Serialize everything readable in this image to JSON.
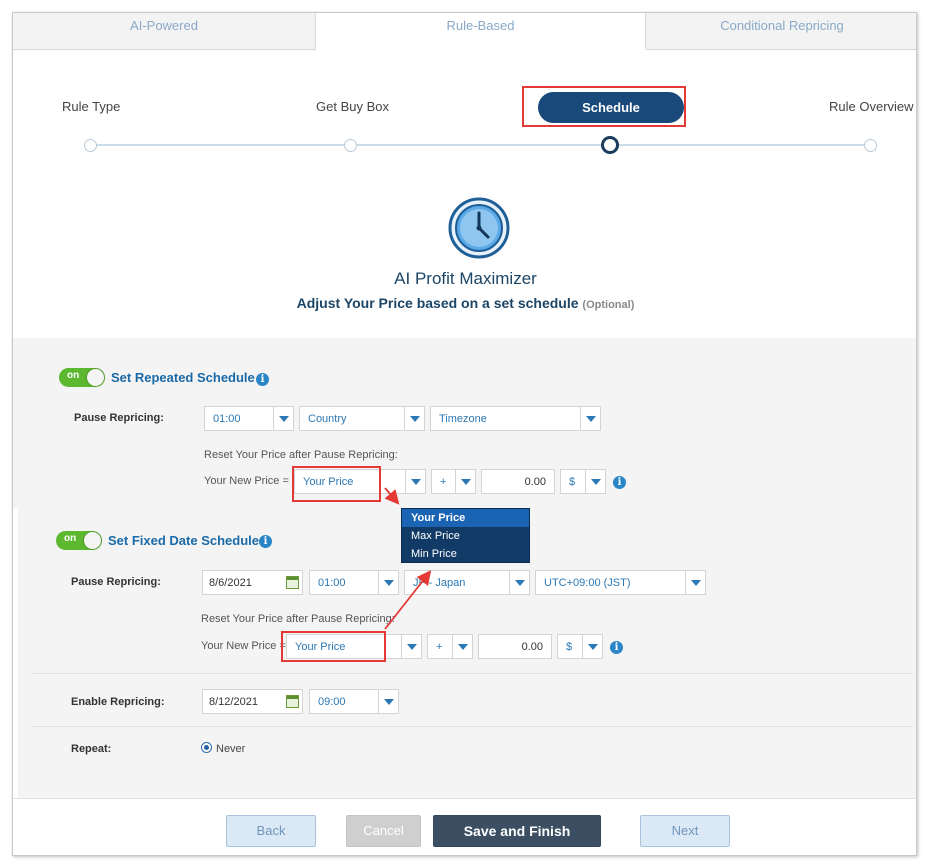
{
  "tabs": [
    {
      "label": "AI-Powered"
    },
    {
      "label": "Rule-Based"
    },
    {
      "label": "Conditional Repricing"
    }
  ],
  "steps": [
    {
      "label": "Rule Type"
    },
    {
      "label": "Get Buy Box"
    },
    {
      "label": "Schedule"
    },
    {
      "label": "Rule Overview"
    }
  ],
  "header": {
    "title": "AI Profit Maximizer",
    "subtitle": "Adjust Your Price based on a set schedule",
    "optional": "(Optional)"
  },
  "repeated": {
    "toggle": "on",
    "title": "Set Repeated Schedule",
    "pause_label": "Pause Repricing:",
    "time": "01:00",
    "country": "Country",
    "timezone": "Timezone",
    "reset_note": "Reset Your Price after Pause Repricing:",
    "new_price_label": "Your New Price =",
    "price_type": "Your Price",
    "operator": "+",
    "amount": "0.00",
    "currency": "$"
  },
  "dropdown": {
    "options": [
      "Your Price",
      "Max Price",
      "Min Price"
    ]
  },
  "fixed": {
    "toggle": "on",
    "title": "Set Fixed Date Schedule",
    "pause_label": "Pause Repricing:",
    "date": "8/6/2021",
    "time": "01:00",
    "country": "JP - Japan",
    "timezone": "UTC+09:00 (JST)",
    "reset_note": "Reset Your Price after Pause Repricing:",
    "new_price_label": "Your New Price =",
    "price_type": "Your Price",
    "operator": "+",
    "amount": "0.00",
    "currency": "$",
    "enable_label": "Enable Repricing:",
    "enable_date": "8/12/2021",
    "enable_time": "09:00",
    "repeat_label": "Repeat:",
    "repeat_value": "Never"
  },
  "buttons": {
    "back": "Back",
    "cancel": "Cancel",
    "save": "Save and Finish",
    "next": "Next"
  },
  "colors": {
    "accent": "#19487a",
    "toggle_on": "#5cb82e",
    "highlight": "#e53935"
  }
}
